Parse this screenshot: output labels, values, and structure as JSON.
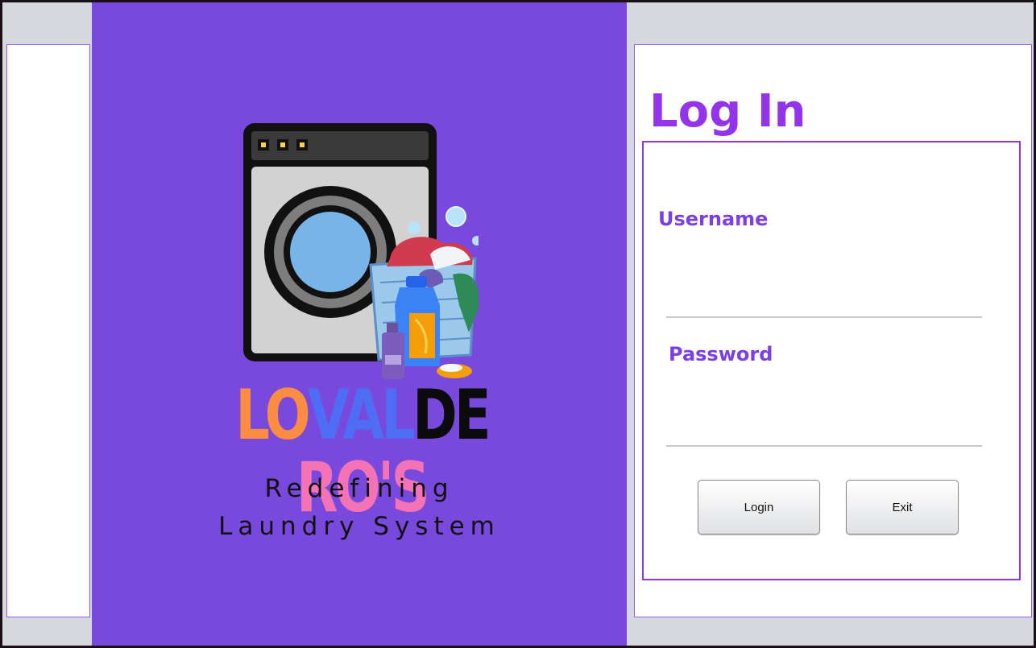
{
  "branding": {
    "name_parts": [
      {
        "text": "LO",
        "color": "#fb8c42"
      },
      {
        "text": "VAL",
        "color": "#4f6cf5"
      },
      {
        "text": "DE",
        "color": "#0b0b0b"
      },
      {
        "text": "RO'S",
        "color": "#f472b6"
      }
    ],
    "tagline_line1": "Redefining",
    "tagline_line2": "Laundry System",
    "panel_color": "#7948dc"
  },
  "login": {
    "title": "Log In",
    "username_label": "Username",
    "username_value": "",
    "password_label": "Password",
    "password_value": "",
    "login_button": "Login",
    "exit_button": "Exit",
    "accent_color": "#9333ea"
  }
}
